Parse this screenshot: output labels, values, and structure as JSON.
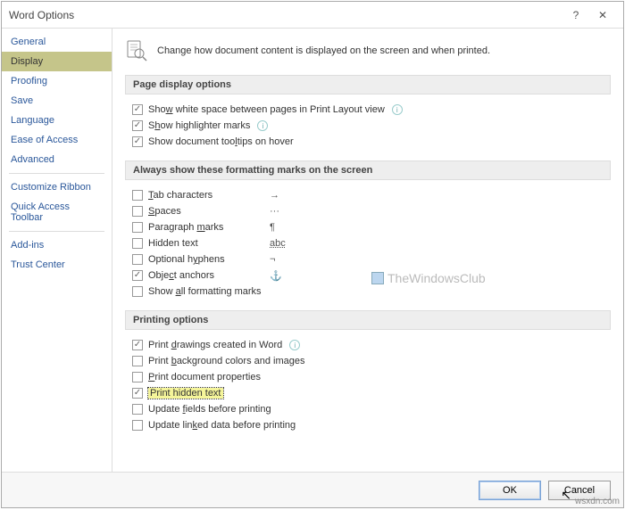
{
  "title": "Word Options",
  "intro": "Change how document content is displayed on the screen and when printed.",
  "sidebar": {
    "items": [
      {
        "label": "General"
      },
      {
        "label": "Display"
      },
      {
        "label": "Proofing"
      },
      {
        "label": "Save"
      },
      {
        "label": "Language"
      },
      {
        "label": "Ease of Access"
      },
      {
        "label": "Advanced"
      },
      {
        "label": "Customize Ribbon"
      },
      {
        "label": "Quick Access Toolbar"
      },
      {
        "label": "Add-ins"
      },
      {
        "label": "Trust Center"
      }
    ],
    "selected_index": 1
  },
  "sections": {
    "page_display": {
      "title": "Page display options",
      "items": [
        {
          "label": "Show white space between pages in Print Layout view",
          "checked": true,
          "info": true,
          "u": "w"
        },
        {
          "label": "Show highlighter marks",
          "checked": true,
          "info": true,
          "u": "h"
        },
        {
          "label": "Show document tooltips on hover",
          "checked": true,
          "u": "l"
        }
      ]
    },
    "formatting": {
      "title": "Always show these formatting marks on the screen",
      "items": [
        {
          "label": "Tab characters",
          "checked": false,
          "sym": "→",
          "u": "T"
        },
        {
          "label": "Spaces",
          "checked": false,
          "sym": "···",
          "u": "S"
        },
        {
          "label": "Paragraph marks",
          "checked": false,
          "sym": "¶",
          "u": "m"
        },
        {
          "label": "Hidden text",
          "checked": false,
          "sym": "abc",
          "u2": true
        },
        {
          "label": "Optional hyphens",
          "checked": false,
          "sym": "¬",
          "u": "y"
        },
        {
          "label": "Object anchors",
          "checked": true,
          "sym": "⚓",
          "u": "c"
        },
        {
          "label": "Show all formatting marks",
          "checked": false,
          "u": "a"
        }
      ]
    },
    "printing": {
      "title": "Printing options",
      "items": [
        {
          "label": "Print drawings created in Word",
          "checked": true,
          "info": true,
          "u": "d"
        },
        {
          "label": "Print background colors and images",
          "checked": false,
          "u": "b"
        },
        {
          "label": "Print document properties",
          "checked": false,
          "u": "p"
        },
        {
          "label": "Print hidden text",
          "checked": true,
          "highlight": true
        },
        {
          "label": "Update fields before printing",
          "checked": false,
          "u": "f"
        },
        {
          "label": "Update linked data before printing",
          "checked": false,
          "u": "k"
        }
      ]
    }
  },
  "buttons": {
    "ok": "OK",
    "cancel": "Cancel"
  },
  "watermark": "TheWindowsClub",
  "url": "wsxdn.com"
}
